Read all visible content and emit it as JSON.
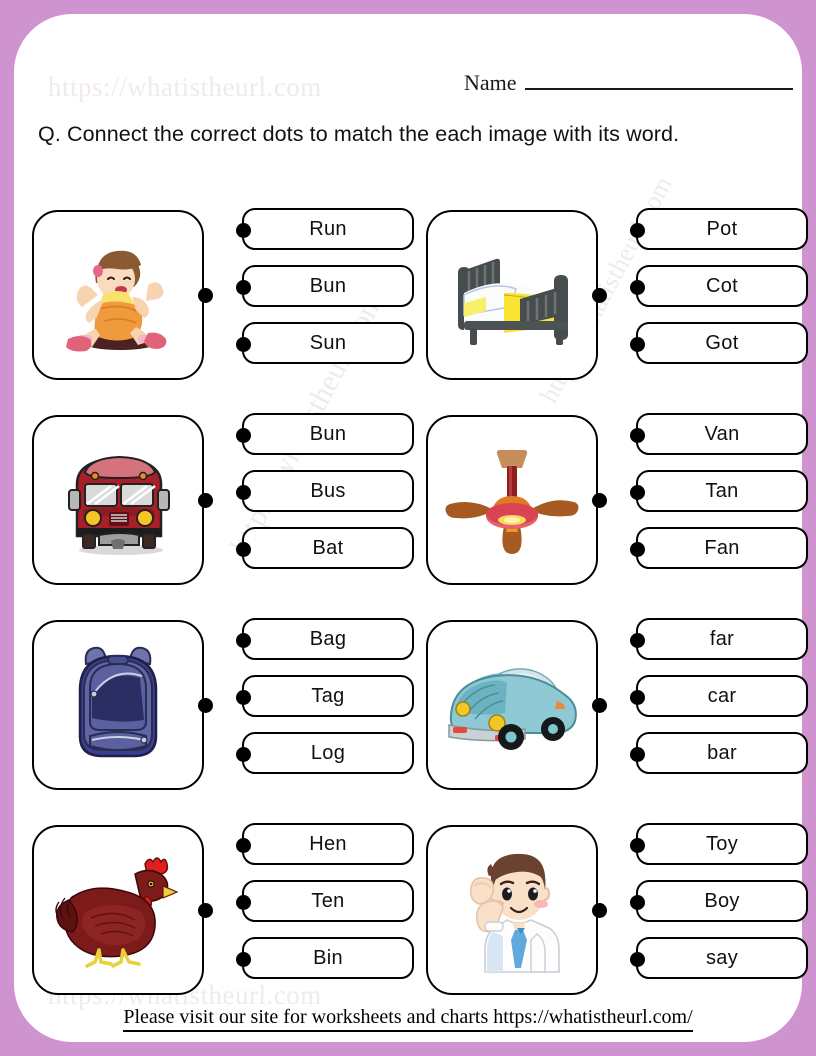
{
  "page": {
    "border_color": "#cf93cf",
    "sheet_color": "#ffffff",
    "watermark_text": "https://whatistheurl.com"
  },
  "header": {
    "watermark": "https://whatistheurl.com",
    "name_label": "Name",
    "name_value": ""
  },
  "instruction": "Q. Connect the correct dots to match the each image with its word.",
  "questions": [
    {
      "image": "girl-running",
      "image_alt": "A girl running",
      "words": [
        "Run",
        "Bun",
        "Sun"
      ]
    },
    {
      "image": "bed",
      "image_alt": "A bed / cot",
      "words": [
        "Pot",
        "Cot",
        "Got"
      ]
    },
    {
      "image": "bus",
      "image_alt": "A red bus",
      "words": [
        "Bun",
        "Bus",
        "Bat"
      ]
    },
    {
      "image": "ceiling-fan",
      "image_alt": "A ceiling fan",
      "words": [
        "Van",
        "Tan",
        "Fan"
      ]
    },
    {
      "image": "backpack",
      "image_alt": "A blue backpack / bag",
      "words": [
        "Bag",
        "Tag",
        "Log"
      ]
    },
    {
      "image": "car",
      "image_alt": "A light blue car",
      "words": [
        "far",
        "car",
        "bar"
      ]
    },
    {
      "image": "hen",
      "image_alt": "A dark red hen",
      "words": [
        "Hen",
        "Ten",
        "Bin"
      ]
    },
    {
      "image": "boy",
      "image_alt": "A boy flexing his arm",
      "words": [
        "Toy",
        "Boy",
        "say"
      ]
    }
  ],
  "footer": {
    "text": "Please visit our site for worksheets and charts https://whatistheurl.com/"
  }
}
